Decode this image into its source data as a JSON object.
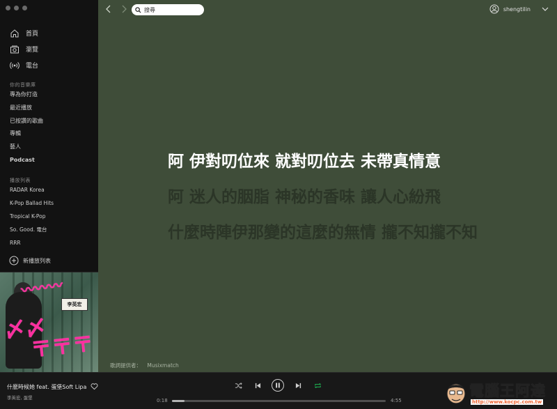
{
  "sidebar": {
    "nav": [
      {
        "label": "首頁",
        "icon": "home-icon"
      },
      {
        "label": "瀏覽",
        "icon": "browse-icon"
      },
      {
        "label": "電台",
        "icon": "radio-icon"
      }
    ],
    "library_title": "你的音樂庫",
    "library": [
      "專為你打造",
      "最近播放",
      "已按讚的歌曲",
      "專輯",
      "藝人",
      "Podcast"
    ],
    "playlists_title": "播放列表",
    "playlists": [
      "RADAR Korea",
      "K-Pop Ballad Hits",
      "Tropical K-Pop",
      "So. Good. 電台",
      "RRR"
    ],
    "new_playlist": "新播放列表"
  },
  "album_art": {
    "label": "李英宏"
  },
  "header": {
    "search_placeholder": "搜尋",
    "username": "shengtilin"
  },
  "lyrics": {
    "lines": [
      {
        "text": "阿 伊對叨位來 就對叨位去 未帶真情意",
        "active": true
      },
      {
        "text": "阿 迷人的胭脂 神秘的香味 讓人心紛飛",
        "active": false
      },
      {
        "text": "什麼時陣伊那變的這麼的無情 攏不知攏不知",
        "active": false
      }
    ],
    "provider_label": "歌詞提供者：",
    "provider_name": "Musixmatch"
  },
  "player": {
    "title": "什麼時候她 feat. 蛋堡Soft Lipa",
    "artist": "李英宏, 蛋堡",
    "current_time": "0:18",
    "total_time": "4:55",
    "progress": 0.06,
    "accent": "#1db954"
  },
  "watermark": {
    "text": "電腦王阿達",
    "url": "http://www.kocpc.com.tw"
  }
}
